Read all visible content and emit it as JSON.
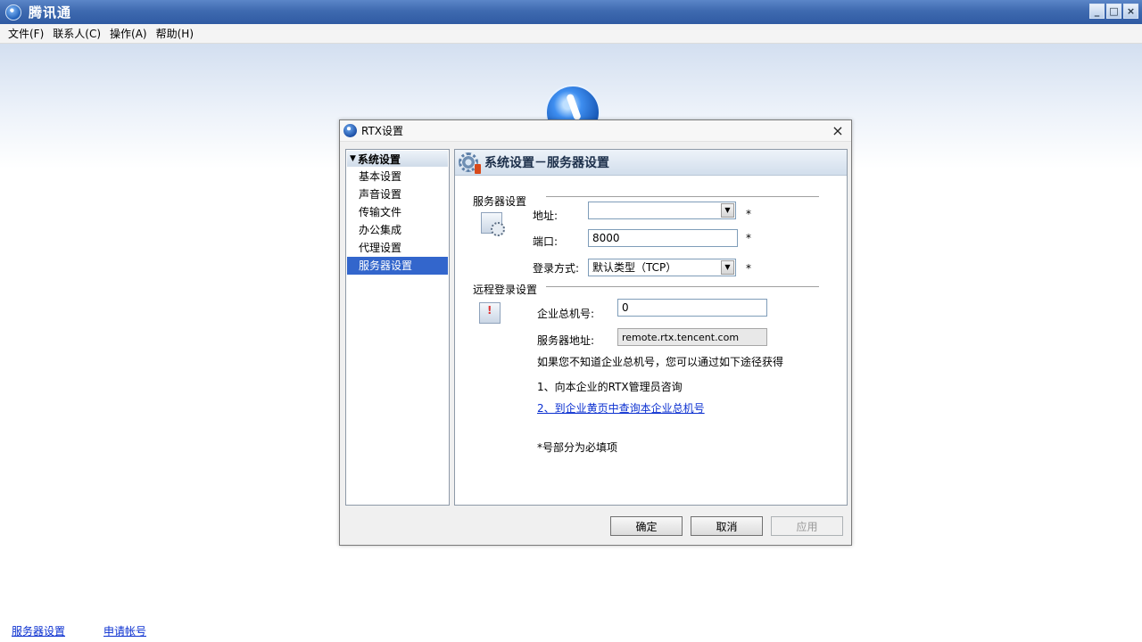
{
  "window": {
    "title": "腾讯通",
    "controls": {
      "minimize": "_",
      "maximize": "□",
      "close": "×"
    }
  },
  "menu": [
    {
      "label": "文件(F)"
    },
    {
      "label": "联系人(C)"
    },
    {
      "label": "操作(A)"
    },
    {
      "label": "帮助(H)"
    }
  ],
  "footer_links": {
    "server_settings": "服务器设置",
    "apply_account": "申请帐号"
  },
  "dialog": {
    "title": "RTX设置",
    "close_symbol": "×",
    "nav": {
      "group": "系统设置",
      "items": [
        "基本设置",
        "声音设置",
        "传输文件",
        "办公集成",
        "代理设置",
        "服务器设置"
      ],
      "selected": "服务器设置"
    },
    "header_title": "系统设置－服务器设置",
    "server_section": {
      "title": "服务器设置",
      "address_label": "地址:",
      "address_value": "",
      "port_label": "端口:",
      "port_value": "8000",
      "login_mode_label": "登录方式:",
      "login_mode_value": "默认类型（TCP）",
      "required_mark": "*"
    },
    "remote_section": {
      "title": "远程登录设置",
      "company_number_label": "企业总机号:",
      "company_number_value": "0",
      "server_address_label": "服务器地址:",
      "server_address_value": "remote.rtx.tencent.com",
      "hint": "如果您不知道企业总机号，您可以通过如下途径获得",
      "option1": "1、向本企业的RTX管理员咨询",
      "option2": "2、到企业黄页中查询本企业总机号",
      "required_note": "*号部分为必填项"
    },
    "buttons": {
      "ok": "确定",
      "cancel": "取消",
      "apply": "应用"
    }
  }
}
